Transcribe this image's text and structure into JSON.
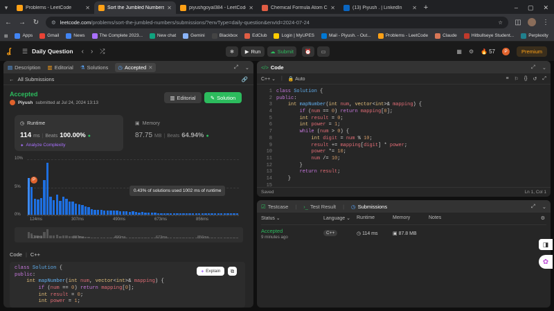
{
  "browser": {
    "tabs": [
      {
        "label": "Problems - LeetCode",
        "color": "#ffa116",
        "active": false
      },
      {
        "label": "Sort the Jumbled Numbers - Lee",
        "color": "#ffa116",
        "active": true
      },
      {
        "label": "piyushgoyal384 - LeetCode Pro",
        "color": "#ffa116",
        "active": false
      },
      {
        "label": "Chemical Formula Atom Count",
        "color": "#e05d44",
        "active": false
      },
      {
        "label": "(13) Piyush . | LinkedIn",
        "color": "#0a66c2",
        "active": false
      }
    ],
    "new_tab": "+",
    "url_host": "leetcode.com",
    "url_path": "/problems/sort-the-jumbled-numbers/submissions/?envType=daily-question&envId=2024-07-24",
    "bookmarks": [
      "Apps",
      "Gmail",
      "News",
      "The Complete 2023...",
      "New chat",
      "Gemini",
      "Blackbox",
      "EdClub",
      "Login | MyUPES",
      "Mail - Piyush. - Out...",
      "Problems - LeetCode",
      "Claude",
      "Hitbullseye Student...",
      "Perplexity"
    ]
  },
  "lc": {
    "daily": "Daily Question",
    "run": "Run",
    "submit": "Submit",
    "streak": "57",
    "premium": "Premium",
    "avatar": "P"
  },
  "left": {
    "tabs": [
      "Description",
      "Editorial",
      "Solutions",
      "Accepted"
    ],
    "all_submissions": "All Submissions",
    "status": "Accepted",
    "user": "Piyush",
    "submitted": "submitted at Jul 24, 2024 13:13",
    "editorial_btn": "Editorial",
    "solution_btn": "Solution",
    "runtime_label": "Runtime",
    "runtime_value": "114",
    "runtime_unit": "ms",
    "beats_label": "Beats",
    "runtime_beats": "100.00%",
    "analyze": "Analyze Complexity",
    "memory_label": "Memory",
    "memory_value": "87.75",
    "memory_unit": "MB",
    "memory_beats": "64.94%",
    "tooltip": "0.43% of solutions used 1002 ms of runtime",
    "code_label": "Code",
    "lang": "C++",
    "explain": "Explain"
  },
  "chart_data": {
    "type": "bar",
    "y_ticks": [
      "10%",
      "5%",
      "0%"
    ],
    "ylim": [
      0,
      10
    ],
    "x_ticks": [
      "124ms",
      "307ms",
      "490ms",
      "673ms",
      "856ms"
    ],
    "values": [
      6.5,
      5.0,
      2.9,
      2.7,
      3.0,
      6.2,
      9.2,
      3.2,
      2.6,
      3.6,
      2.5,
      3.2,
      2.8,
      2.4,
      2.3,
      2.0,
      1.9,
      1.7,
      1.5,
      1.3,
      1.0,
      0.9,
      0.9,
      0.9,
      0.8,
      0.8,
      0.8,
      0.7,
      0.8,
      0.6,
      0.6,
      0.6,
      0.5,
      0.6,
      0.5,
      0.4,
      0.5,
      0.4,
      0.4,
      0.4,
      0.4,
      0.3,
      0.3,
      0.3,
      0.3,
      0.3,
      0.3,
      0.3,
      0.3,
      0.3,
      0.3,
      0.3,
      0.3,
      0.3,
      0.3,
      0.3,
      0.3,
      0.3,
      0.3,
      0.3,
      0.3,
      0.3,
      0.3,
      0.3,
      0.3,
      0.3,
      0.3
    ],
    "highlight_index": 0
  },
  "left_code": [
    "class Solution {",
    "public:",
    "    int mapNumber(int num, vector<int>& mapping) {",
    "        if (num == 0) return mapping[0];",
    "        int result = 0;",
    "        int power = 1;"
  ],
  "editor": {
    "title": "Code",
    "lang": "C++",
    "mode": "Auto",
    "saved": "Saved",
    "pos": "Ln 1, Col 1",
    "lines": [
      "class Solution {",
      "public:",
      "    int mapNumber(int num, vector<int>& mapping) {",
      "        if (num == 0) return mapping[0];",
      "        int result = 0;",
      "        int power = 1;",
      "        while (num > 0) {",
      "            int digit = num % 10;",
      "            result += mapping[digit] * power;",
      "            power *= 10;",
      "            num /= 10;",
      "        }",
      "        return result;",
      "    }",
      ""
    ],
    "line_numbers": [
      "1",
      "2",
      "3",
      "4",
      "5",
      "6",
      "7",
      "8",
      "9",
      "10",
      "11",
      "12",
      "13",
      "14",
      "15"
    ]
  },
  "bottom": {
    "tabs": [
      "Testcase",
      "Test Result",
      "Submissions"
    ],
    "cols": [
      "Status",
      "Language",
      "Runtime",
      "Memory",
      "Notes"
    ],
    "row": {
      "status": "Accepted",
      "time": "9 minutes ago",
      "lang": "C++",
      "runtime": "114 ms",
      "memory": "87.8 MB"
    }
  }
}
